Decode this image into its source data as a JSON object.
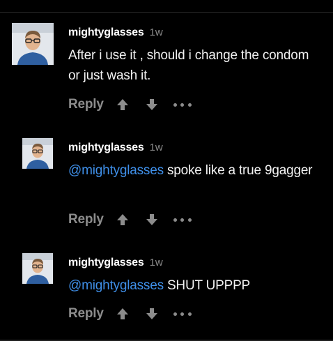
{
  "colors": {
    "background": "#000000",
    "username": "#ffffff",
    "timestamp": "#8a8a8a",
    "mention": "#3f8fe8",
    "action": "#8c8c8c"
  },
  "comments": [
    {
      "username": "mightyglasses",
      "time": "1w",
      "mention": "",
      "text": "After i use it , should i change the condom or just wash it.",
      "reply_label": "Reply",
      "avatar_icon": "avatar-photo-icon"
    },
    {
      "username": "mightyglasses",
      "time": "1w",
      "mention": "@mightyglasses",
      "text": " spoke like a true 9gagger",
      "reply_label": "Reply",
      "avatar_icon": "avatar-photo-icon"
    },
    {
      "username": "mightyglasses",
      "time": "1w",
      "mention": "@mightyglasses",
      "text": " SHUT UPPPP",
      "reply_label": "Reply",
      "avatar_icon": "avatar-photo-icon"
    }
  ],
  "icons": {
    "upvote": "arrow-up-icon",
    "downvote": "arrow-down-icon",
    "more": "more-dots-icon"
  }
}
